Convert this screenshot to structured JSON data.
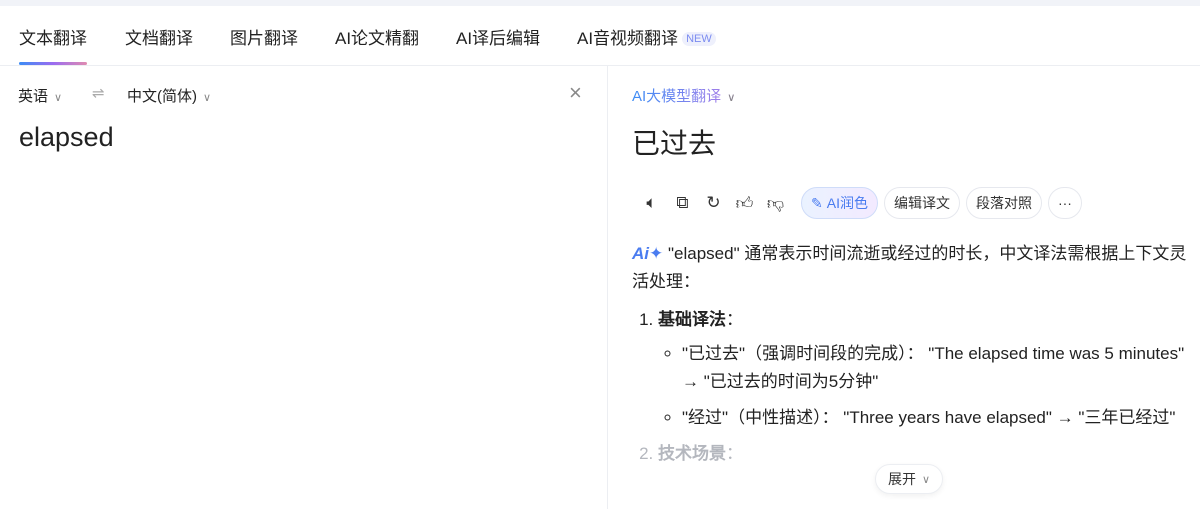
{
  "tabs": [
    {
      "label": "文本翻译"
    },
    {
      "label": "文档翻译"
    },
    {
      "label": "图片翻译"
    },
    {
      "label": "AI论文精翻"
    },
    {
      "label": "AI译后编辑"
    },
    {
      "label": "AI音视频翻译",
      "badge": "NEW"
    }
  ],
  "source": {
    "lang": "英语",
    "target_lang": "中文(简体)",
    "text": "elapsed"
  },
  "target": {
    "model": "AI大模型翻译",
    "text": "已过去",
    "tools": {
      "polish": "AI润色",
      "edit": "编辑译文",
      "compare": "段落对照",
      "more": "···"
    },
    "explanation": {
      "intro": "\"elapsed\" 通常表示时间流逝或经过的时长，中文译法需根据上下文灵活处理：",
      "sections": [
        {
          "title": "基础译法",
          "suffix": "：",
          "bullets": [
            "\"已过去\"（强调时间段的完成）： \"The elapsed time was 5 minutes\" → \"已过去的时间为5分钟\"",
            "\"经过\"（中性描述）： \"Three years have elapsed\" → \"三年已经过\""
          ]
        },
        {
          "title": "技术场景",
          "suffix": "："
        }
      ]
    },
    "expand": "展开"
  },
  "colors": {
    "accent": "#4a7cf0",
    "underline_gradient": [
      "#3b8cf5",
      "#9a6cf0",
      "#e08bb0"
    ]
  }
}
